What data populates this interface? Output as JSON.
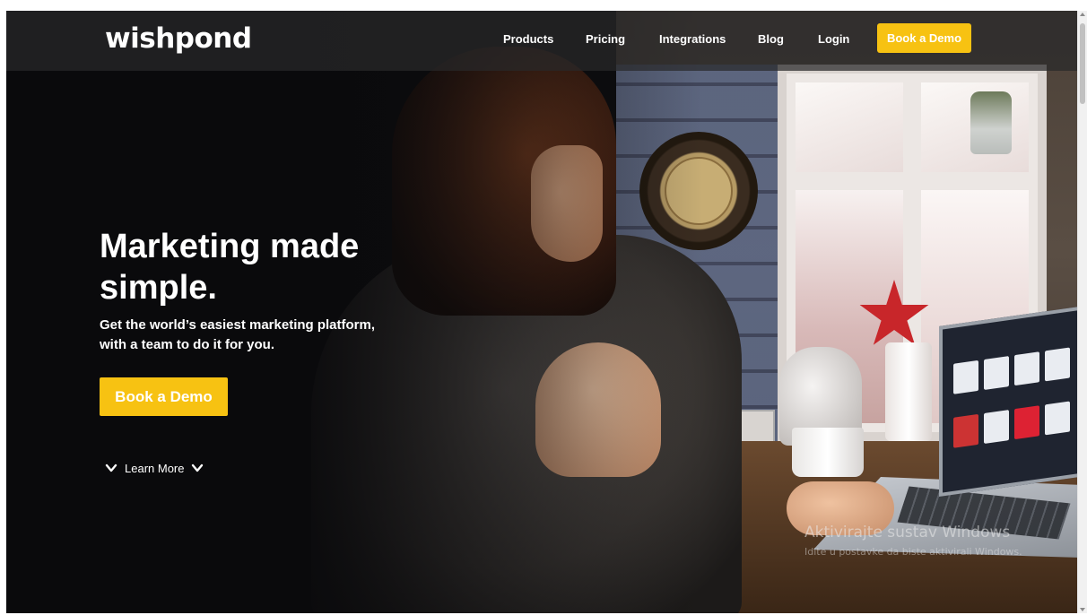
{
  "brand": {
    "logo": "wishpond",
    "accent_color": "#f7c212"
  },
  "nav": {
    "items": [
      {
        "label": "Products"
      },
      {
        "label": "Pricing"
      },
      {
        "label": "Integrations"
      },
      {
        "label": "Blog"
      },
      {
        "label": "Login"
      }
    ],
    "cta_label": "Book a Demo"
  },
  "hero": {
    "headline": "Marketing made simple.",
    "subtitle": "Get the world’s easiest marketing platform, with a team to do it for you.",
    "cta_label": "Book a Demo",
    "learn_more_label": "Learn More"
  },
  "watermark": {
    "line1": "Aktivirajte sustav Windows",
    "line2": "Idite u postavke da biste aktivirali Windows."
  },
  "icons": {
    "learn_more_left": "chevron-down-icon",
    "learn_more_right": "chevron-down-icon"
  }
}
